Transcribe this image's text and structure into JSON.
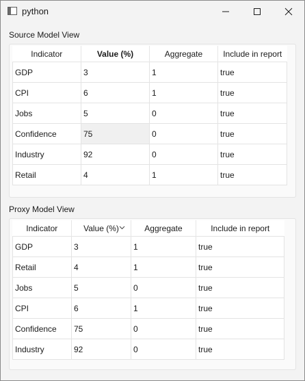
{
  "window": {
    "title": "python"
  },
  "source_view": {
    "title": "Source Model View",
    "headers": [
      "Indicator",
      "Value (%)",
      "Aggregate",
      "Include in report"
    ],
    "rows": [
      [
        "GDP",
        "3",
        "1",
        "true"
      ],
      [
        "CPI",
        "6",
        "1",
        "true"
      ],
      [
        "Jobs",
        "5",
        "0",
        "true"
      ],
      [
        "Confidence",
        "75",
        "0",
        "true"
      ],
      [
        "Industry",
        "92",
        "0",
        "true"
      ],
      [
        "Retail",
        "4",
        "1",
        "true"
      ]
    ]
  },
  "proxy_view": {
    "title": "Proxy Model View",
    "headers": [
      "Indicator",
      "Value (%)",
      "Aggregate",
      "Include in report"
    ],
    "sort_icon": "chevron-down-icon",
    "rows": [
      [
        "GDP",
        "3",
        "1",
        "true"
      ],
      [
        "Retail",
        "4",
        "1",
        "true"
      ],
      [
        "Jobs",
        "5",
        "0",
        "true"
      ],
      [
        "CPI",
        "6",
        "1",
        "true"
      ],
      [
        "Confidence",
        "75",
        "0",
        "true"
      ],
      [
        "Industry",
        "92",
        "0",
        "true"
      ]
    ]
  }
}
